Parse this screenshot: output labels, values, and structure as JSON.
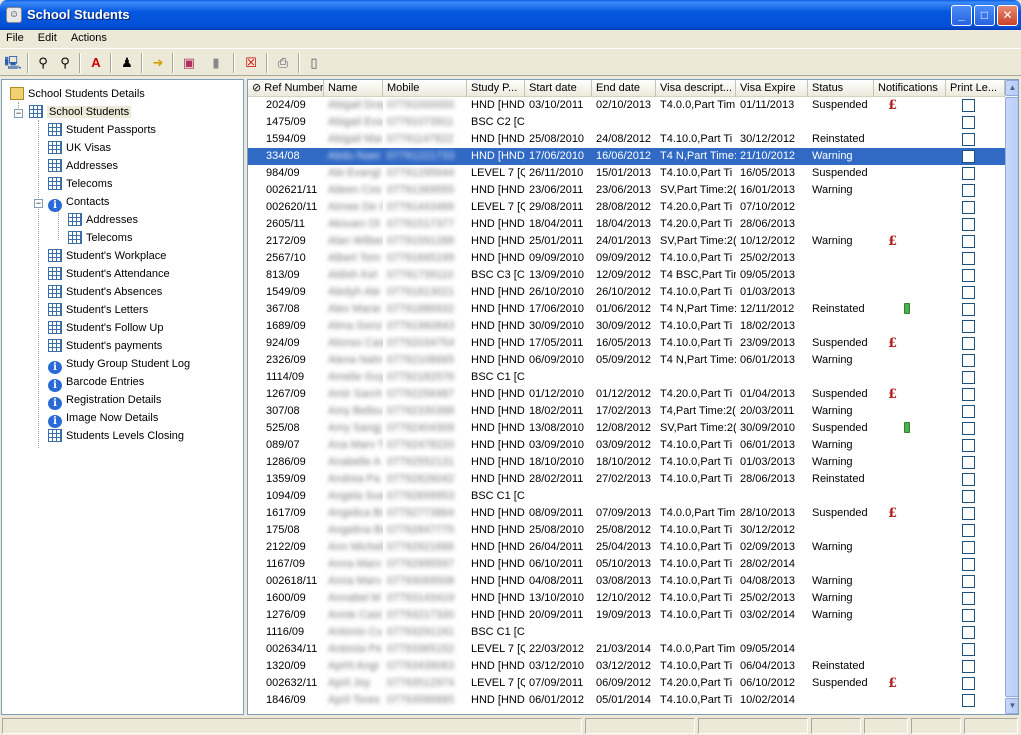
{
  "window": {
    "title": "School Students"
  },
  "menu": [
    "File",
    "Edit",
    "Actions"
  ],
  "toolbar_icons": [
    "computer-icon",
    "binoculars-icon",
    "binoculars-next-icon",
    "pdf-icon",
    "user-icon",
    "export-icon",
    "report-icon",
    "chat-icon",
    "cancel-icon",
    "printer-icon",
    "phone-icon"
  ],
  "tree": {
    "root": "School Students Details",
    "child": "School Students",
    "items": [
      "Student Passports",
      "UK Visas",
      "Addresses",
      "Telecoms"
    ],
    "contacts": "Contacts",
    "contacts_items": [
      "Addresses",
      "Telecoms"
    ],
    "items2": [
      "Student's Workplace",
      "Student's Attendance",
      "Student's Absences",
      "Student's Letters",
      "Student's Follow Up",
      "Student's payments"
    ],
    "info_items": [
      "Study Group Student Log",
      "Barcode Entries",
      "Registration Details",
      "Image Now Details"
    ],
    "last": "Students Levels Closing"
  },
  "columns": [
    "Ref Number",
    "Name",
    "Mobile",
    "Study P...",
    "Start date",
    "End date",
    "Visa descript...",
    "Visa Expire",
    "Status",
    "Notifications",
    "Print Le..."
  ],
  "rows": [
    {
      "ref": "2024/09",
      "study": "HND [HND]",
      "start": "03/10/2011",
      "end": "02/10/2013",
      "visa": "T4.0.0,Part Tim",
      "expire": "01/11/2013",
      "status": "Suspended",
      "notif": "pound"
    },
    {
      "ref": "1475/09",
      "study": "BSC C2 [Cc",
      "start": "",
      "end": "",
      "visa": "",
      "expire": "",
      "status": "",
      "notif": ""
    },
    {
      "ref": "1594/09",
      "study": "HND [HND]",
      "start": "25/08/2010",
      "end": "24/08/2012",
      "visa": "T4.10.0,Part Ti",
      "expire": "30/12/2012",
      "status": "Reinstated",
      "notif": ""
    },
    {
      "ref": "334/08",
      "study": "HND [HND]",
      "start": "17/06/2010",
      "end": "16/06/2012",
      "visa": "T4 N,Part Time:",
      "expire": "21/10/2012",
      "status": "Warning",
      "notif": "",
      "selected": true
    },
    {
      "ref": "984/09",
      "study": "LEVEL 7 [Q",
      "start": "26/11/2010",
      "end": "15/01/2013",
      "visa": "T4.10.0,Part Ti",
      "expire": "16/05/2013",
      "status": "Suspended",
      "notif": ""
    },
    {
      "ref": "002621/11",
      "study": "HND [HND:",
      "start": "23/06/2011",
      "end": "23/06/2013",
      "visa": "SV,Part Time:2(",
      "expire": "16/01/2013",
      "status": "Warning",
      "notif": ""
    },
    {
      "ref": "002620/11",
      "study": "LEVEL 7 [Q",
      "start": "29/08/2011",
      "end": "28/08/2012",
      "visa": "T4.20.0,Part Ti",
      "expire": "07/10/2012",
      "status": "",
      "notif": ""
    },
    {
      "ref": "2605/11",
      "study": "HND [HND:",
      "start": "18/04/2011",
      "end": "18/04/2013",
      "visa": "T4.20.0,Part Ti",
      "expire": "28/06/2013",
      "status": "",
      "notif": ""
    },
    {
      "ref": "2172/09",
      "study": "HND [HND:",
      "start": "25/01/2011",
      "end": "24/01/2013",
      "visa": "SV,Part Time:2(",
      "expire": "10/12/2012",
      "status": "Warning",
      "notif": "pound"
    },
    {
      "ref": "2567/10",
      "study": "HND [HND:",
      "start": "09/09/2010",
      "end": "09/09/2012",
      "visa": "T4.10.0,Part Ti",
      "expire": "25/02/2013",
      "status": "",
      "notif": ""
    },
    {
      "ref": "813/09",
      "study": "BSC C3 [Cc",
      "start": "13/09/2010",
      "end": "12/09/2012",
      "visa": "T4 BSC,Part Tin",
      "expire": "09/05/2013",
      "status": "",
      "notif": ""
    },
    {
      "ref": "1549/09",
      "study": "HND [HND:",
      "start": "26/10/2010",
      "end": "26/10/2012",
      "visa": "T4.10.0,Part Ti",
      "expire": "01/03/2013",
      "status": "",
      "notif": ""
    },
    {
      "ref": "367/08",
      "study": "HND [HND]",
      "start": "17/06/2010",
      "end": "01/06/2012",
      "visa": "T4 N,Part Time:",
      "expire": "12/11/2012",
      "status": "Reinstated",
      "notif": "phone"
    },
    {
      "ref": "1689/09",
      "study": "HND [HND:",
      "start": "30/09/2010",
      "end": "30/09/2012",
      "visa": "T4.10.0,Part Ti",
      "expire": "18/02/2013",
      "status": "",
      "notif": ""
    },
    {
      "ref": "924/09",
      "study": "HND [HND:",
      "start": "17/05/2011",
      "end": "16/05/2013",
      "visa": "T4.10.0,Part Ti",
      "expire": "23/09/2013",
      "status": "Suspended",
      "notif": "pound"
    },
    {
      "ref": "2326/09",
      "study": "HND [HND]",
      "start": "06/09/2010",
      "end": "05/09/2012",
      "visa": "T4 N,Part Time:",
      "expire": "06/01/2013",
      "status": "Warning",
      "notif": ""
    },
    {
      "ref": "1114/09",
      "study": "BSC C1 [Cc",
      "start": "",
      "end": "",
      "visa": "",
      "expire": "",
      "status": "",
      "notif": ""
    },
    {
      "ref": "1267/09",
      "study": "HND [HND:",
      "start": "01/12/2010",
      "end": "01/12/2012",
      "visa": "T4.20.0,Part Ti",
      "expire": "01/04/2013",
      "status": "Suspended",
      "notif": "pound"
    },
    {
      "ref": "307/08",
      "study": "HND [HND:",
      "start": "18/02/2011",
      "end": "17/02/2013",
      "visa": "T4,Part Time:2(",
      "expire": "20/03/2011",
      "status": "Warning",
      "notif": ""
    },
    {
      "ref": "525/08",
      "study": "HND [HND:",
      "start": "13/08/2010",
      "end": "12/08/2012",
      "visa": "SV,Part Time:2(",
      "expire": "30/09/2010",
      "status": "Suspended",
      "notif": "phone"
    },
    {
      "ref": "089/07",
      "study": "HND [HND:",
      "start": "03/09/2010",
      "end": "03/09/2012",
      "visa": "T4.10.0,Part Ti",
      "expire": "06/01/2013",
      "status": "Warning",
      "notif": ""
    },
    {
      "ref": "1286/09",
      "study": "HND [HND:",
      "start": "18/10/2010",
      "end": "18/10/2012",
      "visa": "T4.10.0,Part Ti",
      "expire": "01/03/2013",
      "status": "Warning",
      "notif": ""
    },
    {
      "ref": "1359/09",
      "study": "HND [HND:",
      "start": "28/02/2011",
      "end": "27/02/2013",
      "visa": "T4.10.0,Part Ti",
      "expire": "28/06/2013",
      "status": "Reinstated",
      "notif": ""
    },
    {
      "ref": "1094/09",
      "study": "BSC C1 [Cc",
      "start": "",
      "end": "",
      "visa": "",
      "expire": "",
      "status": "",
      "notif": ""
    },
    {
      "ref": "1617/09",
      "study": "HND [HND:",
      "start": "08/09/2011",
      "end": "07/09/2013",
      "visa": "T4.0.0,Part Tim",
      "expire": "28/10/2013",
      "status": "Suspended",
      "notif": "pound"
    },
    {
      "ref": "175/08",
      "study": "HND [HND:",
      "start": "25/08/2010",
      "end": "25/08/2012",
      "visa": "T4.10.0,Part Ti",
      "expire": "30/12/2012",
      "status": "",
      "notif": ""
    },
    {
      "ref": "2122/09",
      "study": "HND [HND:",
      "start": "26/04/2011",
      "end": "25/04/2013",
      "visa": "T4.10.0,Part Ti",
      "expire": "02/09/2013",
      "status": "Warning",
      "notif": ""
    },
    {
      "ref": "1167/09",
      "study": "HND [HND:",
      "start": "06/10/2011",
      "end": "05/10/2013",
      "visa": "T4.10.0,Part Ti",
      "expire": "28/02/2014",
      "status": "",
      "notif": ""
    },
    {
      "ref": "002618/11",
      "study": "HND [HND:",
      "start": "04/08/2011",
      "end": "03/08/2013",
      "visa": "T4.10.0,Part Ti",
      "expire": "04/08/2013",
      "status": "Warning",
      "notif": ""
    },
    {
      "ref": "1600/09",
      "study": "HND [HND:",
      "start": "13/10/2010",
      "end": "12/10/2012",
      "visa": "T4.10.0,Part Ti",
      "expire": "25/02/2013",
      "status": "Warning",
      "notif": ""
    },
    {
      "ref": "1276/09",
      "study": "HND [HND:",
      "start": "20/09/2011",
      "end": "19/09/2013",
      "visa": "T4.10.0,Part Ti",
      "expire": "03/02/2014",
      "status": "Warning",
      "notif": ""
    },
    {
      "ref": "1116/09",
      "study": "BSC C1 [Cc",
      "start": "",
      "end": "",
      "visa": "",
      "expire": "",
      "status": "",
      "notif": ""
    },
    {
      "ref": "002634/11",
      "study": "LEVEL 7 [Q",
      "start": "22/03/2012",
      "end": "21/03/2014",
      "visa": "T4.0.0,Part Tim",
      "expire": "09/05/2014",
      "status": "",
      "notif": ""
    },
    {
      "ref": "1320/09",
      "study": "HND [HND:",
      "start": "03/12/2010",
      "end": "03/12/2012",
      "visa": "T4.10.0,Part Ti",
      "expire": "06/04/2013",
      "status": "Reinstated",
      "notif": ""
    },
    {
      "ref": "002632/11",
      "study": "LEVEL 7 [Q",
      "start": "07/09/2011",
      "end": "06/09/2012",
      "visa": "T4.20.0,Part Ti",
      "expire": "06/10/2012",
      "status": "Suspended",
      "notif": "pound"
    },
    {
      "ref": "1846/09",
      "study": "HND [HND:",
      "start": "06/01/2012",
      "end": "05/01/2014",
      "visa": "T4.10.0,Part Ti",
      "expire": "10/02/2014",
      "status": "",
      "notif": ""
    }
  ],
  "colors": {
    "selection": "#316ac5",
    "pound": "#b22222",
    "titlebar": "#0458df"
  }
}
